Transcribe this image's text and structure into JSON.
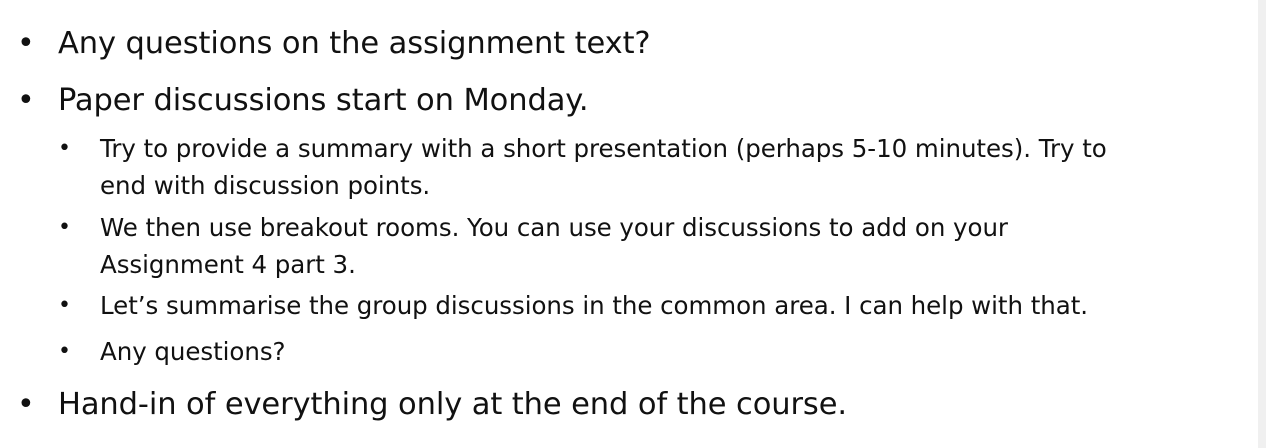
{
  "bullet_symbol": "•",
  "items": [
    {
      "text": "Any questions on the assignment text?"
    },
    {
      "text": "Paper discussions start on Monday.",
      "subitems": [
        {
          "line1": "Try to provide a summary with a short presentation (perhaps 5-10 minutes). Try to",
          "line2": "end with discussion points."
        },
        {
          "line1": "We then use breakout rooms. You can use your discussions to add on your",
          "line2": "Assignment 4 part 3."
        },
        {
          "line1": "Let’s summarise the group discussions in the common area. I can help with that."
        },
        {
          "line1": "Any questions?"
        }
      ]
    },
    {
      "text": "Hand-in of everything only at the end of the course."
    }
  ]
}
